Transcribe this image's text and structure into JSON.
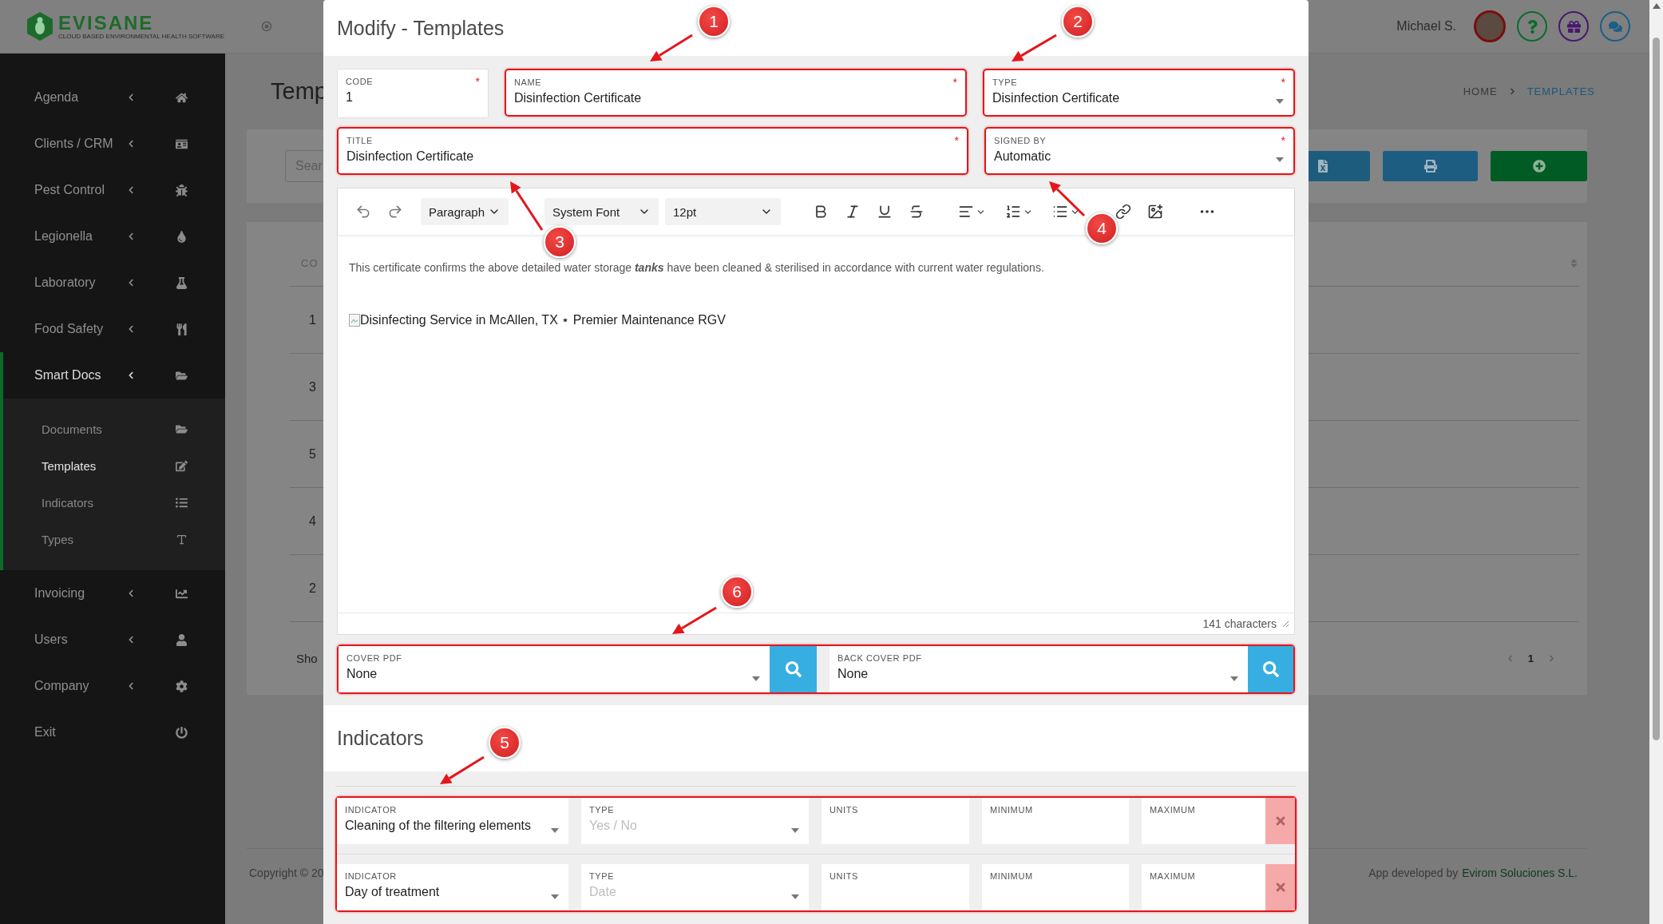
{
  "header": {
    "brand": "EVISANE",
    "tagline": "CLOUD BASED ENVIRONMENTAL HEALTH SOFTWARE",
    "user": "Michael S."
  },
  "sidebar": {
    "items": [
      {
        "label": "Agenda",
        "selected": false,
        "collapsible": true
      },
      {
        "label": "Clients / CRM",
        "selected": false,
        "collapsible": true
      },
      {
        "label": "Pest Control",
        "selected": false,
        "collapsible": true
      },
      {
        "label": "Legionella",
        "selected": false,
        "collapsible": true
      },
      {
        "label": "Laboratory",
        "selected": false,
        "collapsible": true
      },
      {
        "label": "Food Safety",
        "selected": false,
        "collapsible": true
      },
      {
        "label": "Smart Docs",
        "selected": true,
        "collapsible": true,
        "expanded": true,
        "children": [
          {
            "label": "Documents",
            "selected": false
          },
          {
            "label": "Templates",
            "selected": true
          },
          {
            "label": "Indicators",
            "selected": false
          },
          {
            "label": "Types",
            "selected": false
          }
        ]
      },
      {
        "label": "Invoicing",
        "selected": false,
        "collapsible": true
      },
      {
        "label": "Users",
        "selected": false,
        "collapsible": true
      },
      {
        "label": "Company",
        "selected": false,
        "collapsible": true
      },
      {
        "label": "Exit",
        "selected": false,
        "collapsible": false
      }
    ]
  },
  "page": {
    "title": "Temp",
    "breadcrumb": [
      "HOME",
      "TEMPLATES"
    ],
    "search": {
      "placeholder": "Sear"
    },
    "table": {
      "columns": [
        "CO"
      ],
      "rows": [
        "1",
        "3",
        "5",
        "4",
        "2"
      ]
    },
    "showing": "Sho",
    "pagination": {
      "pages": [
        {
          "label": "1",
          "selected": true
        }
      ]
    }
  },
  "footer": {
    "copyright": "Copyright © 20",
    "credit": "App developed by",
    "credit_link": "Evirom Soluciones S.L."
  },
  "modal": {
    "title": "Modify - Templates",
    "form_rows": [
      {
        "fields": [
          {
            "kind": "text",
            "label": "CODE",
            "value": "1",
            "mark": "*",
            "highlighted": false
          },
          {
            "kind": "text",
            "label": "NAME",
            "value": "Disinfection Certificate",
            "mark": "*",
            "highlighted": true
          },
          {
            "kind": "select",
            "label": "TYPE",
            "value": "Disinfection Certificate",
            "mark": "*",
            "highlighted": true
          }
        ]
      },
      {
        "fields": [
          {
            "kind": "text",
            "label": "TITLE",
            "value": "Disinfection Certificate",
            "mark": "*",
            "highlighted": true
          },
          {
            "kind": "select",
            "label": "SIGNED BY",
            "value": "Automatic",
            "mark": "*",
            "highlighted": true
          }
        ]
      }
    ],
    "editor": {
      "toolbar": {
        "block": "Paragraph",
        "font": "System Font",
        "size": "12pt"
      },
      "paragraph": "This certificate confirms the above detailed water storage **tanks** have been cleaned & sterilised in accordance with current water regulations.",
      "image_alt": "Disinfecting Service in McAllen, TX ⋆ Premier Maintenance RGV",
      "count": "141 characters"
    },
    "cover": {
      "highlighted": true,
      "fields": [
        {
          "label": "COVER PDF",
          "value": "None"
        },
        {
          "label": "BACK COVER PDF",
          "value": "None"
        }
      ]
    },
    "indicators": {
      "title": "Indicators",
      "highlighted": true,
      "rows": [
        {
          "fields": [
            {
              "kind": "select",
              "label": "INDICATOR",
              "value": "Cleaning of the filtering elements",
              "disabled": false
            },
            {
              "kind": "select",
              "label": "TYPE",
              "value": "Yes / No",
              "disabled": true
            },
            {
              "kind": "text",
              "label": "UNITS"
            },
            {
              "kind": "text",
              "label": "MINIMUM"
            },
            {
              "kind": "text",
              "label": "MAXIMUM"
            }
          ]
        },
        {
          "fields": [
            {
              "kind": "select",
              "label": "INDICATOR",
              "value": "Day of treatment",
              "disabled": false
            },
            {
              "kind": "select",
              "label": "TYPE",
              "value": "Date",
              "disabled": true
            },
            {
              "kind": "text",
              "label": "UNITS"
            },
            {
              "kind": "text",
              "label": "MINIMUM"
            },
            {
              "kind": "text",
              "label": "MAXIMUM"
            }
          ]
        }
      ]
    }
  },
  "annotations": [
    {
      "number": "1"
    },
    {
      "number": "2"
    },
    {
      "number": "3"
    },
    {
      "number": "4"
    },
    {
      "number": "5"
    },
    {
      "number": "6"
    }
  ]
}
